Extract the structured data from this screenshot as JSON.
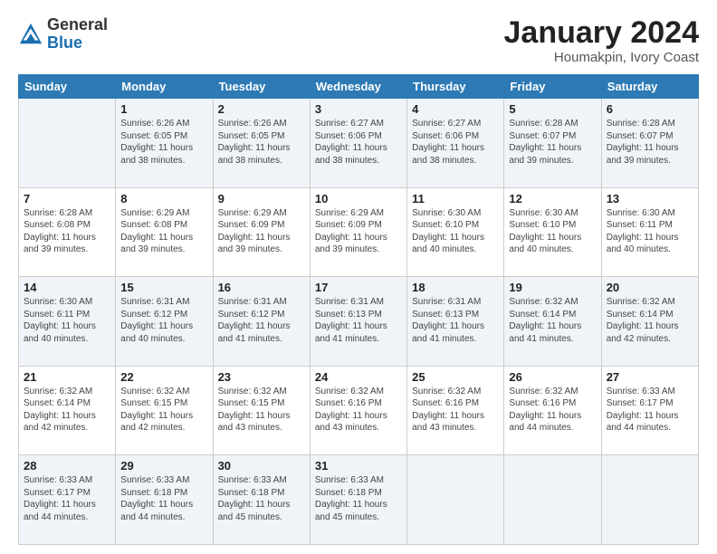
{
  "header": {
    "logo_general": "General",
    "logo_blue": "Blue",
    "main_title": "January 2024",
    "subtitle": "Houmakpin, Ivory Coast"
  },
  "days_of_week": [
    "Sunday",
    "Monday",
    "Tuesday",
    "Wednesday",
    "Thursday",
    "Friday",
    "Saturday"
  ],
  "weeks": [
    [
      {
        "num": "",
        "sunrise": "",
        "sunset": "",
        "daylight": ""
      },
      {
        "num": "1",
        "sunrise": "Sunrise: 6:26 AM",
        "sunset": "Sunset: 6:05 PM",
        "daylight": "Daylight: 11 hours and 38 minutes."
      },
      {
        "num": "2",
        "sunrise": "Sunrise: 6:26 AM",
        "sunset": "Sunset: 6:05 PM",
        "daylight": "Daylight: 11 hours and 38 minutes."
      },
      {
        "num": "3",
        "sunrise": "Sunrise: 6:27 AM",
        "sunset": "Sunset: 6:06 PM",
        "daylight": "Daylight: 11 hours and 38 minutes."
      },
      {
        "num": "4",
        "sunrise": "Sunrise: 6:27 AM",
        "sunset": "Sunset: 6:06 PM",
        "daylight": "Daylight: 11 hours and 38 minutes."
      },
      {
        "num": "5",
        "sunrise": "Sunrise: 6:28 AM",
        "sunset": "Sunset: 6:07 PM",
        "daylight": "Daylight: 11 hours and 39 minutes."
      },
      {
        "num": "6",
        "sunrise": "Sunrise: 6:28 AM",
        "sunset": "Sunset: 6:07 PM",
        "daylight": "Daylight: 11 hours and 39 minutes."
      }
    ],
    [
      {
        "num": "7",
        "sunrise": "Sunrise: 6:28 AM",
        "sunset": "Sunset: 6:08 PM",
        "daylight": "Daylight: 11 hours and 39 minutes."
      },
      {
        "num": "8",
        "sunrise": "Sunrise: 6:29 AM",
        "sunset": "Sunset: 6:08 PM",
        "daylight": "Daylight: 11 hours and 39 minutes."
      },
      {
        "num": "9",
        "sunrise": "Sunrise: 6:29 AM",
        "sunset": "Sunset: 6:09 PM",
        "daylight": "Daylight: 11 hours and 39 minutes."
      },
      {
        "num": "10",
        "sunrise": "Sunrise: 6:29 AM",
        "sunset": "Sunset: 6:09 PM",
        "daylight": "Daylight: 11 hours and 39 minutes."
      },
      {
        "num": "11",
        "sunrise": "Sunrise: 6:30 AM",
        "sunset": "Sunset: 6:10 PM",
        "daylight": "Daylight: 11 hours and 40 minutes."
      },
      {
        "num": "12",
        "sunrise": "Sunrise: 6:30 AM",
        "sunset": "Sunset: 6:10 PM",
        "daylight": "Daylight: 11 hours and 40 minutes."
      },
      {
        "num": "13",
        "sunrise": "Sunrise: 6:30 AM",
        "sunset": "Sunset: 6:11 PM",
        "daylight": "Daylight: 11 hours and 40 minutes."
      }
    ],
    [
      {
        "num": "14",
        "sunrise": "Sunrise: 6:30 AM",
        "sunset": "Sunset: 6:11 PM",
        "daylight": "Daylight: 11 hours and 40 minutes."
      },
      {
        "num": "15",
        "sunrise": "Sunrise: 6:31 AM",
        "sunset": "Sunset: 6:12 PM",
        "daylight": "Daylight: 11 hours and 40 minutes."
      },
      {
        "num": "16",
        "sunrise": "Sunrise: 6:31 AM",
        "sunset": "Sunset: 6:12 PM",
        "daylight": "Daylight: 11 hours and 41 minutes."
      },
      {
        "num": "17",
        "sunrise": "Sunrise: 6:31 AM",
        "sunset": "Sunset: 6:13 PM",
        "daylight": "Daylight: 11 hours and 41 minutes."
      },
      {
        "num": "18",
        "sunrise": "Sunrise: 6:31 AM",
        "sunset": "Sunset: 6:13 PM",
        "daylight": "Daylight: 11 hours and 41 minutes."
      },
      {
        "num": "19",
        "sunrise": "Sunrise: 6:32 AM",
        "sunset": "Sunset: 6:14 PM",
        "daylight": "Daylight: 11 hours and 41 minutes."
      },
      {
        "num": "20",
        "sunrise": "Sunrise: 6:32 AM",
        "sunset": "Sunset: 6:14 PM",
        "daylight": "Daylight: 11 hours and 42 minutes."
      }
    ],
    [
      {
        "num": "21",
        "sunrise": "Sunrise: 6:32 AM",
        "sunset": "Sunset: 6:14 PM",
        "daylight": "Daylight: 11 hours and 42 minutes."
      },
      {
        "num": "22",
        "sunrise": "Sunrise: 6:32 AM",
        "sunset": "Sunset: 6:15 PM",
        "daylight": "Daylight: 11 hours and 42 minutes."
      },
      {
        "num": "23",
        "sunrise": "Sunrise: 6:32 AM",
        "sunset": "Sunset: 6:15 PM",
        "daylight": "Daylight: 11 hours and 43 minutes."
      },
      {
        "num": "24",
        "sunrise": "Sunrise: 6:32 AM",
        "sunset": "Sunset: 6:16 PM",
        "daylight": "Daylight: 11 hours and 43 minutes."
      },
      {
        "num": "25",
        "sunrise": "Sunrise: 6:32 AM",
        "sunset": "Sunset: 6:16 PM",
        "daylight": "Daylight: 11 hours and 43 minutes."
      },
      {
        "num": "26",
        "sunrise": "Sunrise: 6:32 AM",
        "sunset": "Sunset: 6:16 PM",
        "daylight": "Daylight: 11 hours and 44 minutes."
      },
      {
        "num": "27",
        "sunrise": "Sunrise: 6:33 AM",
        "sunset": "Sunset: 6:17 PM",
        "daylight": "Daylight: 11 hours and 44 minutes."
      }
    ],
    [
      {
        "num": "28",
        "sunrise": "Sunrise: 6:33 AM",
        "sunset": "Sunset: 6:17 PM",
        "daylight": "Daylight: 11 hours and 44 minutes."
      },
      {
        "num": "29",
        "sunrise": "Sunrise: 6:33 AM",
        "sunset": "Sunset: 6:18 PM",
        "daylight": "Daylight: 11 hours and 44 minutes."
      },
      {
        "num": "30",
        "sunrise": "Sunrise: 6:33 AM",
        "sunset": "Sunset: 6:18 PM",
        "daylight": "Daylight: 11 hours and 45 minutes."
      },
      {
        "num": "31",
        "sunrise": "Sunrise: 6:33 AM",
        "sunset": "Sunset: 6:18 PM",
        "daylight": "Daylight: 11 hours and 45 minutes."
      },
      {
        "num": "",
        "sunrise": "",
        "sunset": "",
        "daylight": ""
      },
      {
        "num": "",
        "sunrise": "",
        "sunset": "",
        "daylight": ""
      },
      {
        "num": "",
        "sunrise": "",
        "sunset": "",
        "daylight": ""
      }
    ]
  ]
}
